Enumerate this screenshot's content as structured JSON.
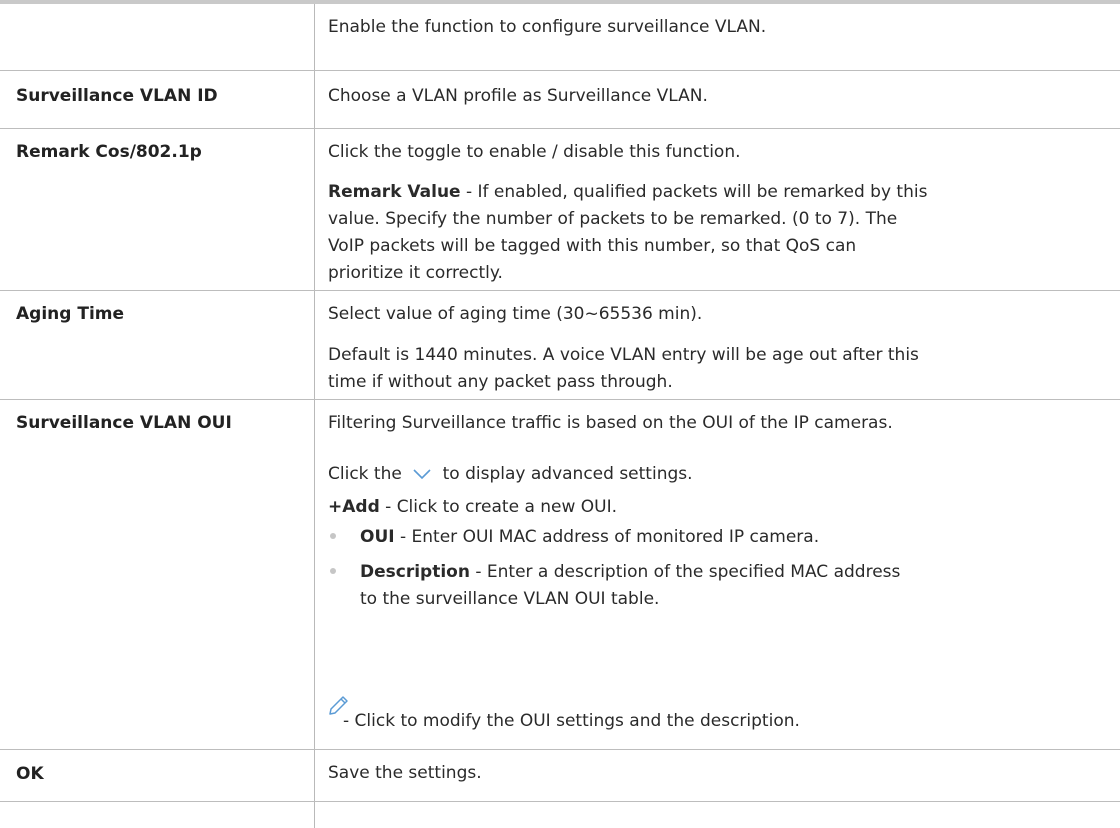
{
  "rows": [
    {
      "label": "",
      "lines": [
        "Enable the function to configure surveillance VLAN."
      ]
    },
    {
      "label": "Surveillance VLAN ID",
      "lines": [
        "Choose a VLAN profile as Surveillance VLAN."
      ]
    },
    {
      "label": "Remark Cos/802.1p",
      "lines": [
        "Click the toggle to enable / disable this function."
      ],
      "remark_value": {
        "term": "Remark Value",
        "desc_lines": [
          " - If enabled, qualified packets will be remarked by this",
          "value. Specify the number of packets to be remarked. (0 to 7). The",
          "VoIP packets will be tagged with this number, so that QoS can",
          "prioritize it correctly."
        ]
      }
    },
    {
      "label": "Aging Time",
      "lines": [
        "Select value of aging time (30~65536 min).",
        "Default is 1440 minutes. A voice VLAN entry will be age out after this",
        "time if without any packet pass through."
      ]
    },
    {
      "label": "Surveillance VLAN OUI",
      "lines": [
        "Filtering Surveillance traffic is based on the OUI of the IP cameras."
      ],
      "click_pre": "Click the",
      "click_post": "to display advanced settings.",
      "add": {
        "term": "+Add",
        "desc": " - Click to create a new OUI."
      },
      "bullets": [
        {
          "term": "OUI",
          "lines": [
            " - Enter OUI MAC address of monitored IP camera."
          ]
        },
        {
          "term": "Description",
          "lines": [
            " - Enter a description of the specified MAC address",
            "to the surveillance VLAN OUI table."
          ]
        }
      ],
      "edit_desc": "- Click to modify the OUI settings and the description."
    },
    {
      "label": "OK",
      "lines": [
        "Save the settings."
      ]
    }
  ],
  "icons": {
    "expand": "chevron-down-icon",
    "edit": "pencil-icon"
  },
  "colors": {
    "icon_blue": "#5b9bd5",
    "border": "#bdbdbd",
    "bullet": "#c6c6c6"
  }
}
